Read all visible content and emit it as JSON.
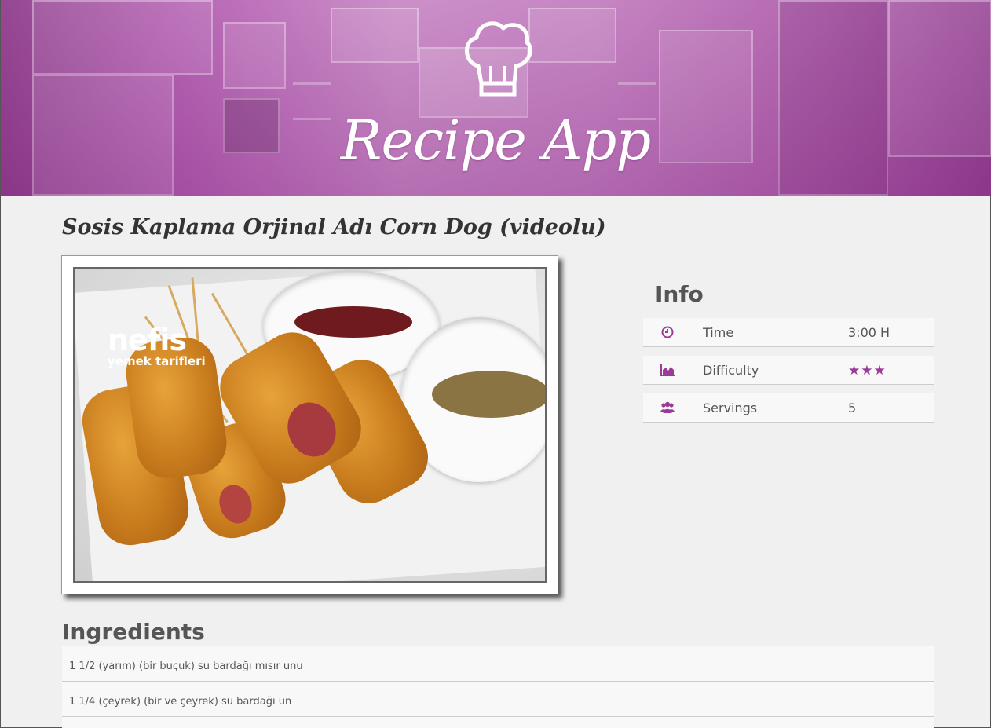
{
  "header": {
    "brand": "Recipe App",
    "accent": "#9a3c97"
  },
  "recipe": {
    "title": "Sosis Kaplama Orjinal Adı Corn Dog (videolu)",
    "image_watermark": {
      "brand": "nefis",
      "tagline": "yemek tarifleri"
    }
  },
  "info": {
    "heading": "Info",
    "rows": [
      {
        "icon": "clock-icon",
        "label": "Time",
        "value": "3:00 H"
      },
      {
        "icon": "area-chart-icon",
        "label": "Difficulty",
        "stars": 3,
        "value": "★★★"
      },
      {
        "icon": "users-icon",
        "label": "Servings",
        "value": "5"
      }
    ]
  },
  "ingredients": {
    "heading": "Ingredients",
    "items": [
      "1 1/2 (yarım) (bir buçuk) su bardağı mısır unu",
      "1 1/4 (çeyrek) (bir ve çeyrek) su bardağı un"
    ]
  }
}
